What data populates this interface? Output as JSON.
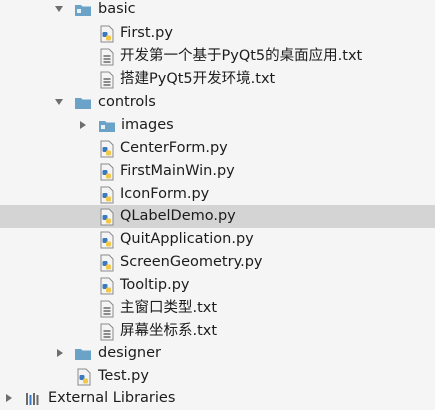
{
  "tree": {
    "rows": [
      {
        "label": "basic",
        "kind": "folder",
        "expanded": true
      },
      {
        "label": "First.py",
        "kind": "python-file"
      },
      {
        "label": "开发第一个基于PyQt5的桌面应用.txt",
        "kind": "text-file"
      },
      {
        "label": "搭建PyQt5开发环境.txt",
        "kind": "text-file"
      },
      {
        "label": "controls",
        "kind": "folder",
        "expanded": true
      },
      {
        "label": "images",
        "kind": "folder",
        "expanded": false
      },
      {
        "label": "CenterForm.py",
        "kind": "python-file"
      },
      {
        "label": "FirstMainWin.py",
        "kind": "python-file"
      },
      {
        "label": "IconForm.py",
        "kind": "python-file"
      },
      {
        "label": "QLabelDemo.py",
        "kind": "python-file",
        "selected": true
      },
      {
        "label": "QuitApplication.py",
        "kind": "python-file"
      },
      {
        "label": "ScreenGeometry.py",
        "kind": "python-file"
      },
      {
        "label": "Tooltip.py",
        "kind": "python-file"
      },
      {
        "label": "主窗口类型.txt",
        "kind": "text-file"
      },
      {
        "label": "屏幕坐标系.txt",
        "kind": "text-file"
      },
      {
        "label": "designer",
        "kind": "folder",
        "expanded": false
      },
      {
        "label": "Test.py",
        "kind": "python-file"
      },
      {
        "label": "External Libraries",
        "kind": "library",
        "expanded": false
      }
    ]
  },
  "colors": {
    "background": "#f5f5f5",
    "selection": "#d4d4d4",
    "folder_blue": "#6aa2c8",
    "python_blue": "#3b78c2",
    "python_yellow": "#f2c84b",
    "text": "#1c1c1c"
  }
}
